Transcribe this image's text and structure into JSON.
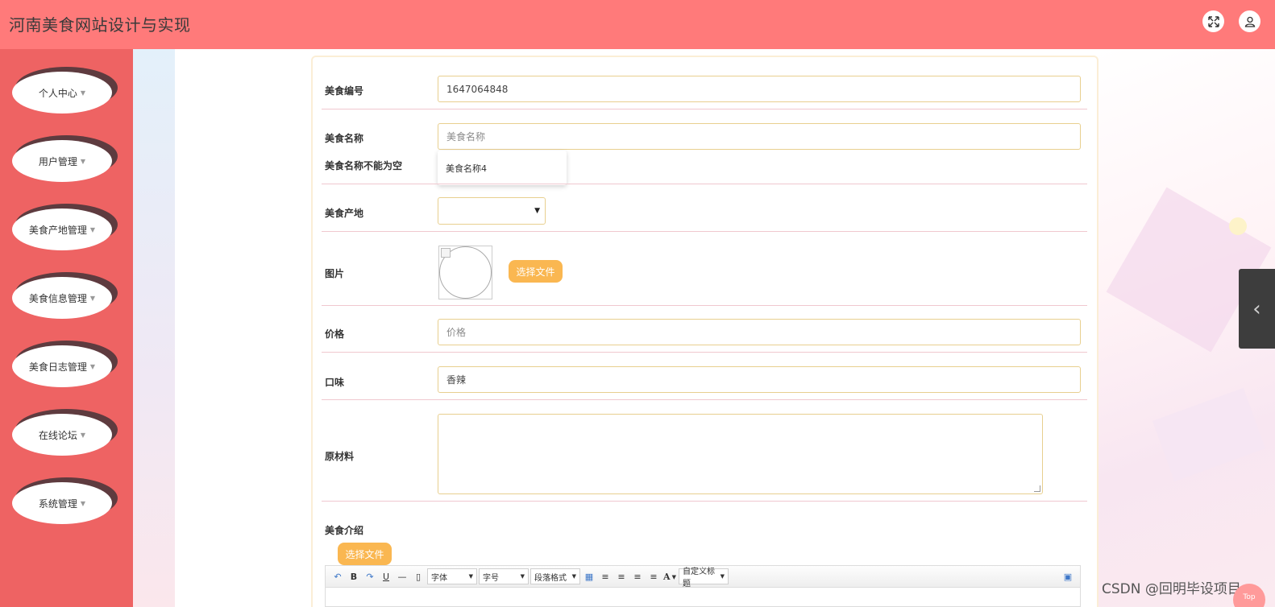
{
  "app": {
    "title": "河南美食网站设计与实现"
  },
  "header": {
    "icons": [
      "fullscreen-icon",
      "user-icon"
    ]
  },
  "sidebar": {
    "items": [
      {
        "label": "个人中心"
      },
      {
        "label": "用户管理"
      },
      {
        "label": "美食产地管理"
      },
      {
        "label": "美食信息管理"
      },
      {
        "label": "美食日志管理"
      },
      {
        "label": "在线论坛"
      },
      {
        "label": "系统管理"
      }
    ]
  },
  "form": {
    "food_id": {
      "label": "美食编号",
      "value": "1647064848"
    },
    "food_name": {
      "label": "美食名称",
      "placeholder": "美食名称",
      "error": "美食名称不能为空",
      "suggestion": "美食名称4"
    },
    "origin": {
      "label": "美食产地",
      "value": ""
    },
    "image": {
      "label": "图片",
      "button": "选择文件"
    },
    "price": {
      "label": "价格",
      "placeholder": "价格"
    },
    "taste": {
      "label": "口味",
      "value": "香辣"
    },
    "ingredients": {
      "label": "原材料",
      "value": ""
    },
    "intro": {
      "label": "美食介绍",
      "button": "选择文件"
    }
  },
  "editor": {
    "font_family": "字体",
    "font_size": "字号",
    "paragraph": "段落格式",
    "custom_title": "自定义标题",
    "bold": "B",
    "underline": "U",
    "font_color": "A"
  },
  "watermark": "CSDN @回明毕设项目",
  "top_badge": "Top"
}
